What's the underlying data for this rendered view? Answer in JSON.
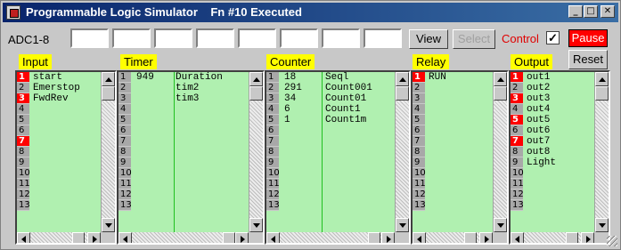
{
  "window": {
    "title": "Programmable Logic Simulator    Fn #10 Executed",
    "minimize_glyph": "_",
    "maximize_glyph": "□",
    "close_glyph": "✕"
  },
  "toolbar": {
    "adc_label": "ADC1-8",
    "adc_values": [
      "",
      "",
      "",
      "",
      "",
      "",
      "",
      ""
    ],
    "view_label": "View",
    "select_label": "Select",
    "control_label": "Control",
    "control_checked_glyph": "✓",
    "pause_label": "Pause",
    "reset_label": "Reset"
  },
  "colors": {
    "list_bg": "#b0f0b0",
    "header_bg": "#ffff00",
    "active_row": "#ff0000",
    "pause_bg": "#ff0000"
  },
  "row_numbers": [
    "1",
    "2",
    "3",
    "4",
    "5",
    "6",
    "7",
    "8",
    "9",
    "10",
    "11",
    "12",
    "13"
  ],
  "panels": {
    "input": {
      "header": "Input",
      "active_rows": [
        1,
        3,
        7
      ],
      "names": [
        "start",
        "Emerstop",
        "FwdRev"
      ]
    },
    "timer": {
      "header": "Timer",
      "active_rows": [],
      "values": [
        "949",
        "",
        ""
      ],
      "names": [
        "Duration",
        "tim2",
        "tim3"
      ]
    },
    "counter": {
      "header": "Counter",
      "active_rows": [],
      "values": [
        "18",
        "291",
        "34",
        "6",
        "1"
      ],
      "names": [
        "Seql",
        "Count001",
        "Count01",
        "Count1",
        "Count1m"
      ]
    },
    "relay": {
      "header": "Relay",
      "active_rows": [
        1
      ],
      "names": [
        "RUN"
      ]
    },
    "output": {
      "header": "Output",
      "active_rows": [
        1,
        3,
        5,
        7
      ],
      "names": [
        "out1",
        "out2",
        "out3",
        "out4",
        "out5",
        "out6",
        "out7",
        "out8",
        "Light"
      ]
    }
  }
}
